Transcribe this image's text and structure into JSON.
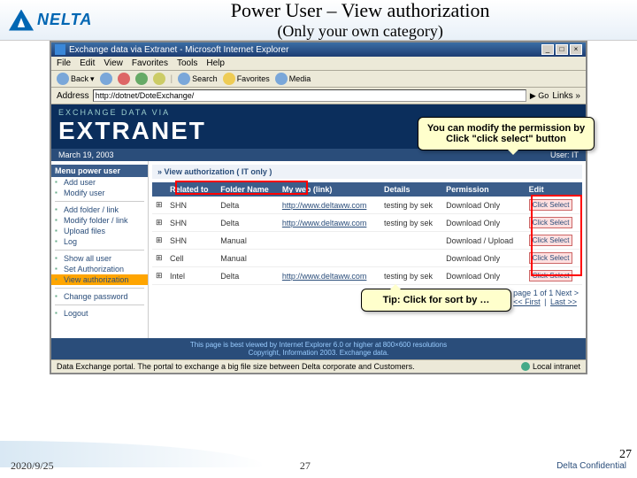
{
  "brand": "NELTA",
  "title": "Power User – View authorization",
  "subtitle": "(Only your own category)",
  "ie": {
    "title": "Exchange data via Extranet - Microsoft Internet Explorer",
    "menu": [
      "File",
      "Edit",
      "View",
      "Favorites",
      "Tools",
      "Help"
    ],
    "back": "Back",
    "search": "Search",
    "favorites": "Favorites",
    "media": "Media",
    "addr_label": "Address",
    "url": "http://dotnet/DoteExchange/",
    "go": "Go",
    "links": "Links »"
  },
  "banner": {
    "top": "EXCHANGE DATA VIA",
    "main": "EXTRANET"
  },
  "datebar": {
    "date": "March 19, 2003",
    "user": "User: IT"
  },
  "sidebar": {
    "head": "Menu power user",
    "g1": [
      "Add user",
      "Modify user"
    ],
    "g2": [
      "Add folder / link",
      "Modify folder / link",
      "Upload files",
      "Log"
    ],
    "g3": [
      "Show all user",
      "Set Authorization",
      "View authorization"
    ],
    "g4": [
      "Change password"
    ],
    "g5": [
      "Logout"
    ]
  },
  "crumb": "» View authorization ( IT only )",
  "table": {
    "headers": [
      "",
      "Related to",
      "Folder Name",
      "My web (link)",
      "Details",
      "Permission",
      "Edit"
    ],
    "rows": [
      {
        "rel": "SHN",
        "folder": "Delta",
        "link": "http://www.deltaww.com",
        "details": "testing by sek",
        "perm": "Download Only",
        "edit": "Click Select"
      },
      {
        "rel": "SHN",
        "folder": "Delta",
        "link": "http://www.deltaww.com",
        "details": "testing by sek",
        "perm": "Download Only",
        "edit": "Click Select"
      },
      {
        "rel": "SHN",
        "folder": "Manual",
        "link": "",
        "details": "",
        "perm": "Download / Upload",
        "edit": "Click Select"
      },
      {
        "rel": "Cell",
        "folder": "Manual",
        "link": "",
        "details": "",
        "perm": "Download Only",
        "edit": "Click Select"
      },
      {
        "rel": "Intel",
        "folder": "Delta",
        "link": "http://www.deltaww.com",
        "details": "testing by sek",
        "perm": "Download Only",
        "edit": "Click Select"
      }
    ]
  },
  "pager": {
    "prev": "< Previous page",
    "of": "1 of 1",
    "next": "Next >",
    "first": "<< First",
    "last": "Last >>"
  },
  "callouts": {
    "bubble": "You can modify the permission by Click \"click select\" button",
    "tip": "Tip: Click for sort by …"
  },
  "page_footer": {
    "l1": "This page is best viewed by Internet Explorer 6.0 or higher at 800×600 resolutions",
    "l2": "Copyright, Information 2003. Exchange data."
  },
  "statusbar": {
    "left": "Data Exchange portal. The portal to exchange a big file size between Delta corporate and Customers.",
    "zone": "Local intranet"
  },
  "slide": {
    "date": "2020/9/25",
    "page": "27",
    "conf": "Delta Confidential",
    "corner": "27"
  }
}
